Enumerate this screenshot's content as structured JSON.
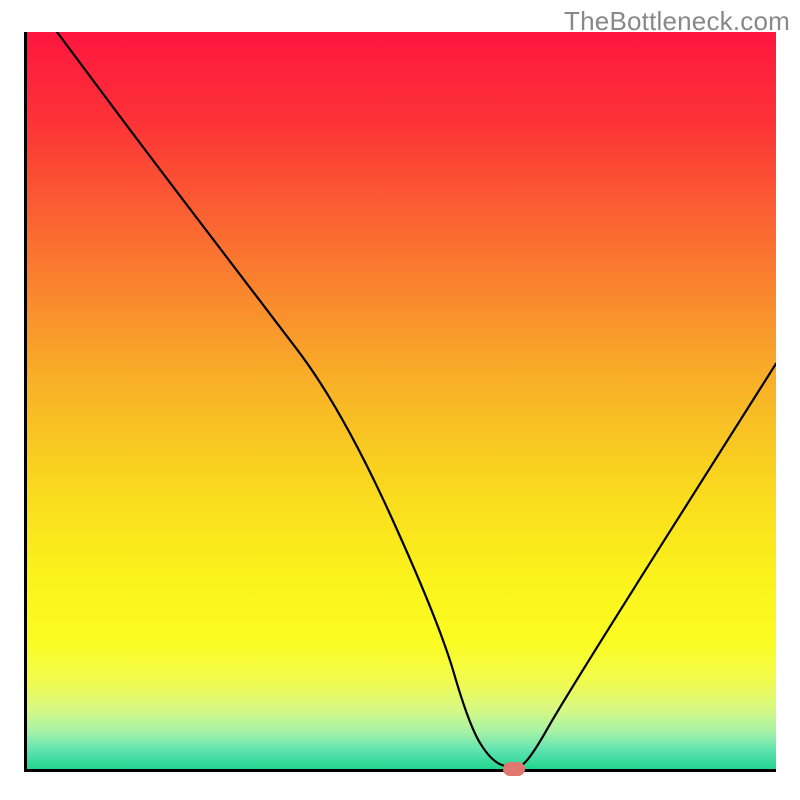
{
  "watermark": "TheBottleneck.com",
  "chart_data": {
    "type": "line",
    "title": "",
    "xlabel": "",
    "ylabel": "",
    "xlim": [
      0,
      100
    ],
    "ylim": [
      0,
      100
    ],
    "x": [
      4,
      15,
      30,
      42,
      55,
      59,
      62,
      65,
      67,
      72,
      100
    ],
    "y": [
      100,
      85,
      65,
      49,
      20,
      6,
      1,
      0,
      1,
      10,
      55
    ],
    "background_gradient_stops": [
      {
        "pos": 0.0,
        "color": "#fe163f"
      },
      {
        "pos": 0.12,
        "color": "#fd3237"
      },
      {
        "pos": 0.3,
        "color": "#fa7430"
      },
      {
        "pos": 0.48,
        "color": "#f8b227"
      },
      {
        "pos": 0.62,
        "color": "#f9d91e"
      },
      {
        "pos": 0.74,
        "color": "#fbf31b"
      },
      {
        "pos": 0.83,
        "color": "#fbfc23"
      },
      {
        "pos": 0.88,
        "color": "#f1fb4d"
      },
      {
        "pos": 0.92,
        "color": "#d6f884"
      },
      {
        "pos": 0.95,
        "color": "#a4f2a8"
      },
      {
        "pos": 0.975,
        "color": "#5ee3b0"
      },
      {
        "pos": 1.0,
        "color": "#22d48e"
      }
    ],
    "marker": {
      "x": 65,
      "y": 0,
      "color": "#e0786f"
    }
  }
}
